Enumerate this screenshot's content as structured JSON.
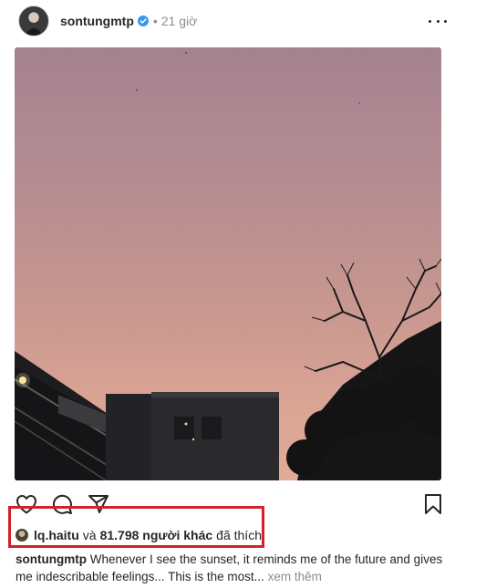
{
  "post": {
    "author": "sontungmtp",
    "verified": true,
    "separator": "•",
    "time_ago": "21 giờ"
  },
  "icons": {
    "like": "heart-icon",
    "comment": "comment-icon",
    "share": "send-icon",
    "save": "bookmark-icon",
    "more": "more-options-icon"
  },
  "likes": {
    "user": "lq.haitu",
    "conjunction": "và",
    "others": "81.798 người khác",
    "suffix": "đã thích"
  },
  "caption": {
    "author": "sontungmtp",
    "text": "Whenever I see the sunset, it reminds me of the future and gives me indescribable feelings... This is the most",
    "ellipsis": "...",
    "more_label": "xem thêm"
  },
  "colors": {
    "verified_blue": "#3897f0",
    "highlight_red": "#d3202a",
    "muted_gray": "#8e8e8e"
  }
}
